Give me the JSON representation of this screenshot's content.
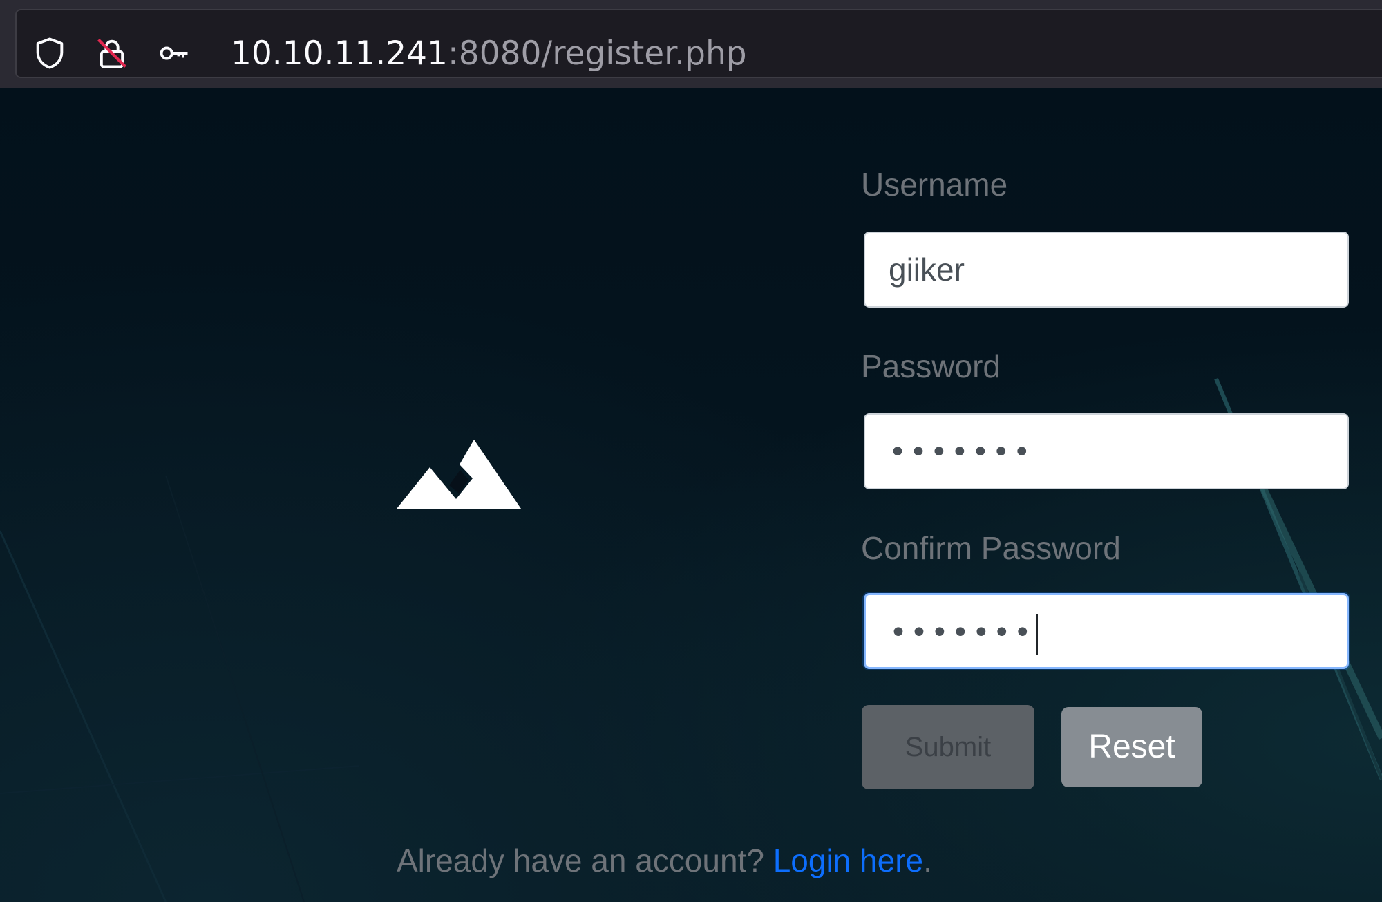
{
  "browser": {
    "url_host": "10.10.11.241",
    "url_path": ":8080/register.php",
    "icons": [
      "shield-icon",
      "insecure-lock-icon",
      "key-icon"
    ]
  },
  "form": {
    "username_label": "Username",
    "username_value": "giiker",
    "password_label": "Password",
    "password_value": "•••••••",
    "confirm_label": "Confirm Password",
    "confirm_value": "•••••••",
    "submit_label": "Submit",
    "reset_label": "Reset"
  },
  "footer": {
    "prompt": "Already have an account? ",
    "link_label": "Login here",
    "suffix": "."
  },
  "colors": {
    "link": "#0d6efd",
    "focus_ring": "#86b7fe",
    "background": "#061019"
  },
  "logo_icon": "mountain-logo-icon"
}
